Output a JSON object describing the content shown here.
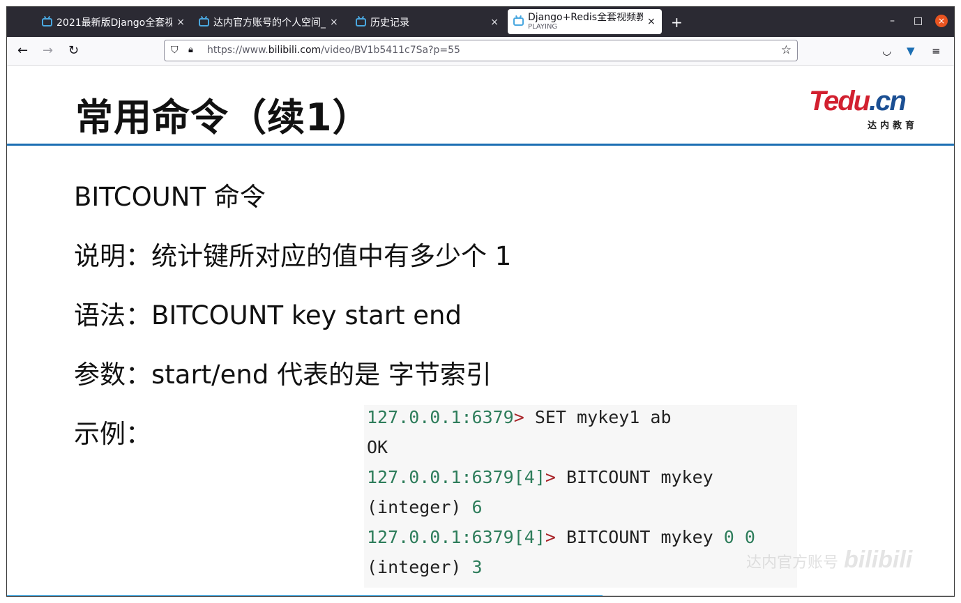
{
  "browser": {
    "tabs": [
      {
        "title": "2021最新版Django全套视",
        "close": "×"
      },
      {
        "title": "达内官方账号的个人空间_",
        "close": "×"
      },
      {
        "title": "历史记录",
        "close": "×"
      },
      {
        "title": "Django+Redis全套视频教",
        "subtitle": "PLAYING",
        "close": "×",
        "active": true
      }
    ],
    "new_tab": "+",
    "window_controls": {
      "minimize": "–",
      "maximize": "□",
      "close": "×"
    },
    "nav": {
      "back": "←",
      "forward": "→",
      "reload": "↻"
    },
    "url": {
      "prefix": "https://www.",
      "domain": "bilibili.com",
      "path": "/video/BV1b5411c7Sa?p=55"
    },
    "icons": [
      "shield-icon",
      "lock-icon",
      "star-icon",
      "pocket-icon",
      "extension-icon",
      "menu-icon"
    ]
  },
  "slide": {
    "title": "常用命令（续1）",
    "logo": {
      "brand_main": "Tedu",
      "brand_suffix": ".cn",
      "sub": "达内教育"
    },
    "lines": [
      "BITCOUNT 命令",
      "说明：统计键所对应的值中有多少个 1",
      "语法：BITCOUNT key start end",
      "参数：start/end 代表的是 字节索引",
      "示例："
    ],
    "code": [
      {
        "host": "127.0.0.1:6379",
        "arrow": ">",
        "cmd": " SET mykey1 ab"
      },
      {
        "plain": "OK"
      },
      {
        "host": "127.0.0.1:6379[4]",
        "arrow": ">",
        "cmd": " BITCOUNT mykey"
      },
      {
        "plain": "(integer) ",
        "num": "6"
      },
      {
        "host": "127.0.0.1:6379[4]",
        "arrow": ">",
        "cmd": " BITCOUNT mykey ",
        "num": "0 0"
      },
      {
        "plain": "(integer) ",
        "num": "3"
      }
    ],
    "watermark": {
      "text": "达内官方账号",
      "logo": "bilibili"
    }
  },
  "player": {
    "progress": 0.629
  },
  "colors": {
    "accent": "#1c6fb3",
    "brand_red": "#d2202f",
    "code_host": "#2e7d5b",
    "code_arrow": "#a8252a"
  }
}
